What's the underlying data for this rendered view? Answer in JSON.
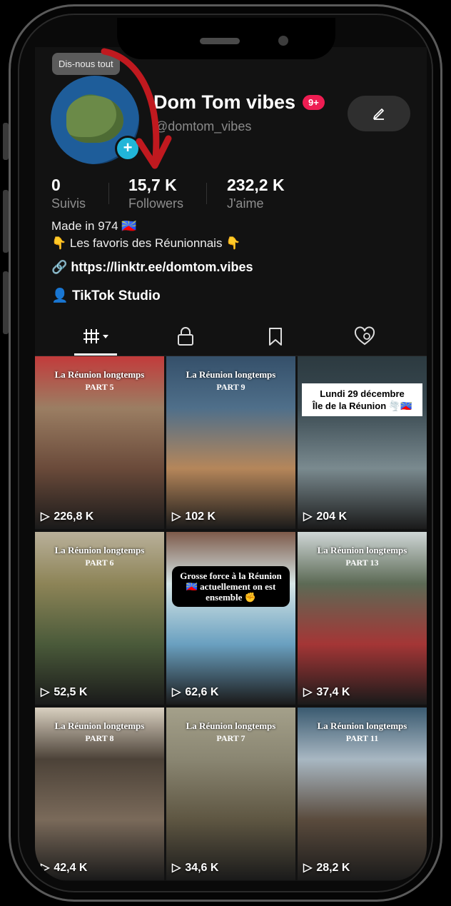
{
  "tooltip": "Dis-nous tout",
  "profile": {
    "name": "Dom Tom vibes",
    "notification_badge": "9+",
    "handle": "@domtom_vibes"
  },
  "stats": [
    {
      "value": "0",
      "label": "Suivis"
    },
    {
      "value": "15,7 K",
      "label": "Followers"
    },
    {
      "value": "232,2 K",
      "label": "J'aime"
    }
  ],
  "bio": {
    "line1": "Made in 974 🇷🇪",
    "line2": "👇 Les favoris des Réunionnais 👇",
    "link": "https://linktr.ee/domtom.vibes",
    "studio": "TikTok Studio"
  },
  "tabs": [
    "videos-tab",
    "private-tab",
    "saved-tab",
    "liked-tab"
  ],
  "videos": [
    {
      "title": "La Réunion longtemps",
      "subtitle": "PART 5",
      "views": "226,8 K",
      "colors": [
        "#9b7e63",
        "#6a4a3a",
        "#c23b3b"
      ]
    },
    {
      "title": "La Réunion longtemps",
      "subtitle": "PART 9",
      "views": "102 K",
      "colors": [
        "#4f6f8a",
        "#b5865a",
        "#35506a"
      ]
    },
    {
      "title": "Lundi 29 décembre",
      "subtitle": "Île de la Réunion 🌪️🇷🇪",
      "views": "204 K",
      "colors": [
        "#3a4a52",
        "#7a8a8f",
        "#2c3a40"
      ]
    },
    {
      "title": "La Réunion longtemps",
      "subtitle": "PART 6",
      "views": "52,5 K",
      "colors": [
        "#8d8457",
        "#4a5a3a",
        "#b9b09a"
      ]
    },
    {
      "title": "Grosse force à la Réunion 🇷🇪 actuellement on est ensemble ✊",
      "subtitle": "",
      "views": "62,6 K",
      "colors": [
        "#d6e6e6",
        "#6aa0c0",
        "#7d5a4a"
      ]
    },
    {
      "title": "La Réunion longtemps",
      "subtitle": "PART 13",
      "views": "37,4 K",
      "colors": [
        "#5c6a55",
        "#a43636",
        "#cfd6d6"
      ]
    },
    {
      "title": "La Réunion longtemps",
      "subtitle": "PART 8",
      "views": "42,4 K",
      "colors": [
        "#4c4238",
        "#7a6a5a",
        "#d9d0c0"
      ]
    },
    {
      "title": "La Réunion longtemps",
      "subtitle": "PART 7",
      "views": "34,6 K",
      "colors": [
        "#8a8672",
        "#5e5642",
        "#a4a08a"
      ]
    },
    {
      "title": "La Réunion longtemps",
      "subtitle": "PART 11",
      "views": "28,2 K",
      "colors": [
        "#a8b7c2",
        "#5a4b3d",
        "#3a5a70"
      ]
    }
  ]
}
